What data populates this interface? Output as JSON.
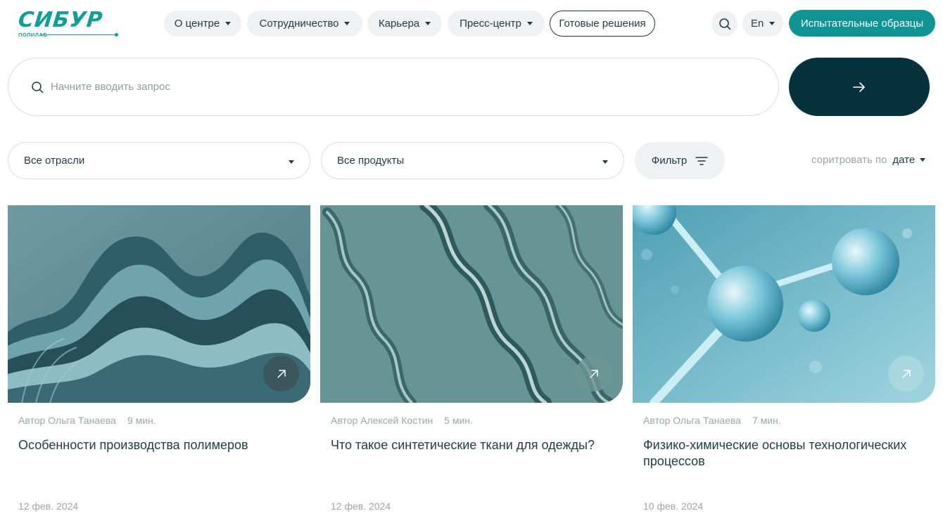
{
  "brand": {
    "name": "СИБУР",
    "sub": "ПОЛИЛАБ",
    "color": "#0f9f98"
  },
  "nav": {
    "items": [
      {
        "label": "О центре",
        "dropdown": true
      },
      {
        "label": "Сотрудничество",
        "dropdown": true
      },
      {
        "label": "Карьера",
        "dropdown": true
      },
      {
        "label": "Пресс-центр",
        "dropdown": true
      },
      {
        "label": "Готовые решения",
        "dropdown": false
      }
    ],
    "search_icon": "search-icon",
    "language": "En",
    "cta": "Испытательные образцы"
  },
  "search": {
    "placeholder": "Начните вводить запрос",
    "value": "",
    "submit_icon": "arrow-right-icon"
  },
  "filters": {
    "industry": "Все отрасли",
    "product": "Все продукты",
    "filter_label": "Фильтр",
    "sort_label": "соритровать по",
    "sort_value": "дате"
  },
  "cards": [
    {
      "author": "Автор Ольга Танаева",
      "read_time": "9 мин.",
      "title": "Особенности производства полимеров",
      "date": "12 фев. 2024",
      "image": "layered-polymer-waves"
    },
    {
      "author": "Автор Алексей Костин",
      "read_time": "5 мин.",
      "title": "Что такое синтетические ткани для одежды?",
      "date": "12 фев. 2024",
      "image": "glass-helix-fibers"
    },
    {
      "author": "Автор Ольга Танаева",
      "read_time": "7 мин.",
      "title": "Физико-химические основы технологических процессов",
      "date": "10 фев. 2024",
      "image": "molecule-spheres"
    }
  ],
  "colors": {
    "accent": "#0f9496",
    "dark": "#06323d",
    "text": "#1f3a44",
    "muted": "#9aa6aa",
    "pill": "#eff1f2"
  }
}
